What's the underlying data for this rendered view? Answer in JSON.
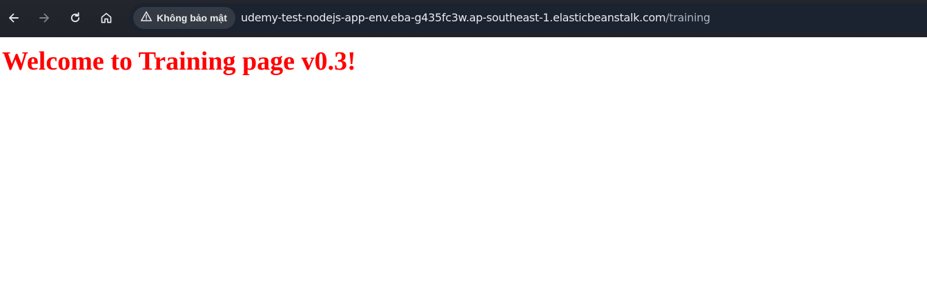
{
  "browser": {
    "toolbar": {
      "back_icon": "arrow-left-icon",
      "forward_icon": "arrow-right-icon",
      "reload_icon": "reload-icon",
      "home_icon": "home-icon"
    },
    "omnibox": {
      "security_label": "Không bảo mật",
      "security_icon": "warning-triangle-icon",
      "url_host": "udemy-test-nodejs-app-env.eba-g435fc3w.ap-southeast-1.elasticbeanstalk.com",
      "url_path": "/training"
    },
    "colors": {
      "toolbar_bg": "#202124",
      "omnibox_bg": "#1b2230",
      "chip_bg": "#343a44",
      "heading": "#ff0000"
    }
  },
  "page": {
    "heading": "Welcome to Training page v0.3!"
  }
}
